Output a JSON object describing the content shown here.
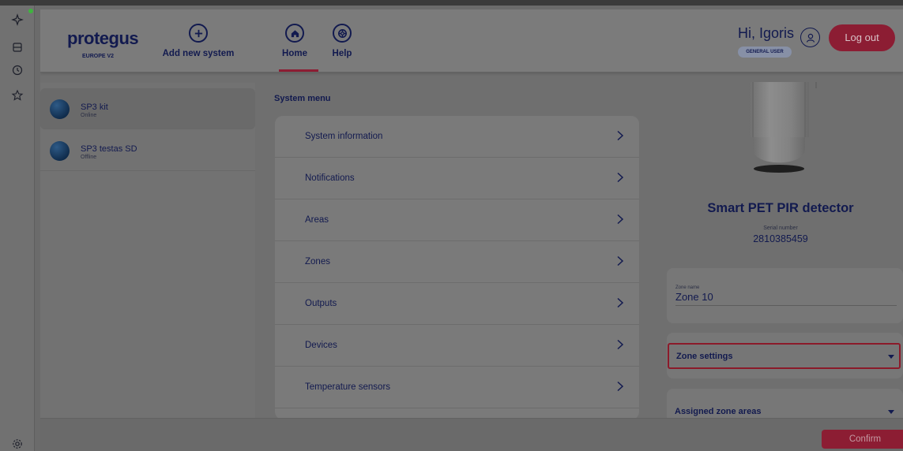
{
  "sidebar_rail": {
    "icons": [
      "sparkle-icon",
      "database-icon",
      "history-icon",
      "star-icon",
      "settings-icon"
    ],
    "status_dot_color": "#3fb43f"
  },
  "header": {
    "logo": "protegus",
    "logo_sub": "EUROPE V2",
    "add_label": "Add new system",
    "home_label": "Home",
    "help_label": "Help",
    "greeting": "Hi, Igoris",
    "role": "GENERAL USER",
    "logout_label": "Log out"
  },
  "systems": [
    {
      "name": "SP3 kit",
      "status": "Online"
    },
    {
      "name": "SP3 testas SD",
      "status": "Offline"
    }
  ],
  "system_menu": {
    "title": "System menu",
    "items": [
      "System information",
      "Notifications",
      "Areas",
      "Zones",
      "Outputs",
      "Devices",
      "Temperature sensors"
    ]
  },
  "device": {
    "name": "Smart PET PIR detector",
    "serial_label": "Serial number",
    "serial_value": "2810385459"
  },
  "zone": {
    "name_label": "Zone name",
    "name_value": "Zone 10",
    "settings_label": "Zone settings",
    "assigned_label": "Assigned zone areas"
  },
  "footer": {
    "confirm_label": "Confirm"
  },
  "colors": {
    "brand_navy": "#121a4f",
    "accent_red": "#8c1d33",
    "highlight_border": "#8b1a2a"
  }
}
